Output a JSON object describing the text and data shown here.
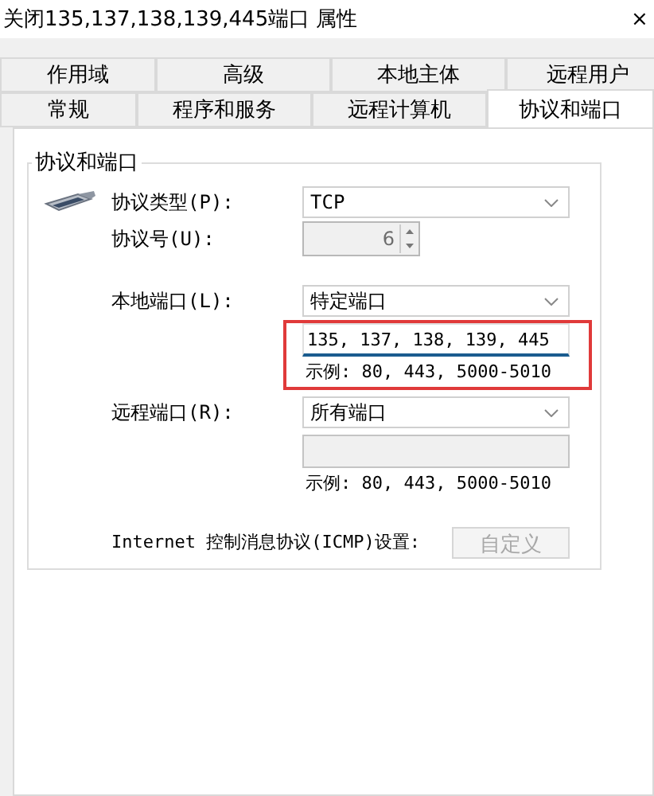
{
  "window": {
    "title": "关闭135,137,138,139,445端口 属性",
    "close": "×"
  },
  "tab_rows": [
    {
      "tabs": [
        {
          "label": "作用域",
          "selected": false
        },
        {
          "label": "高级",
          "selected": false
        },
        {
          "label": "本地主体",
          "selected": false
        },
        {
          "label": "远程用户",
          "selected": false
        }
      ]
    },
    {
      "tabs": [
        {
          "label": "常规",
          "selected": false
        },
        {
          "label": "程序和服务",
          "selected": false
        },
        {
          "label": "远程计算机",
          "selected": false
        },
        {
          "label": "协议和端口",
          "selected": true
        }
      ]
    }
  ],
  "group": {
    "title": "协议和端口"
  },
  "protocol": {
    "type_label": "协议类型(P):",
    "type_value": "TCP",
    "number_label": "协议号(U):",
    "number_value": "6",
    "number_disabled": true
  },
  "ports": [
    {
      "label": "本地端口(L):",
      "value": "特定端口",
      "input": "135, 137, 138, 139, 445",
      "input_disabled": false,
      "focused": true,
      "highlighted": true,
      "example": "示例: 80, 443, 5000-5010"
    },
    {
      "label": "远程端口(R):",
      "value": "所有端口",
      "input_disabled": true,
      "focused": false,
      "highlighted": false,
      "example": "示例: 80, 443, 5000-5010"
    }
  ],
  "icmp": {
    "label": "Internet 控制消息协议(ICMP)设置:",
    "button": "自定义",
    "button_disabled": true
  }
}
